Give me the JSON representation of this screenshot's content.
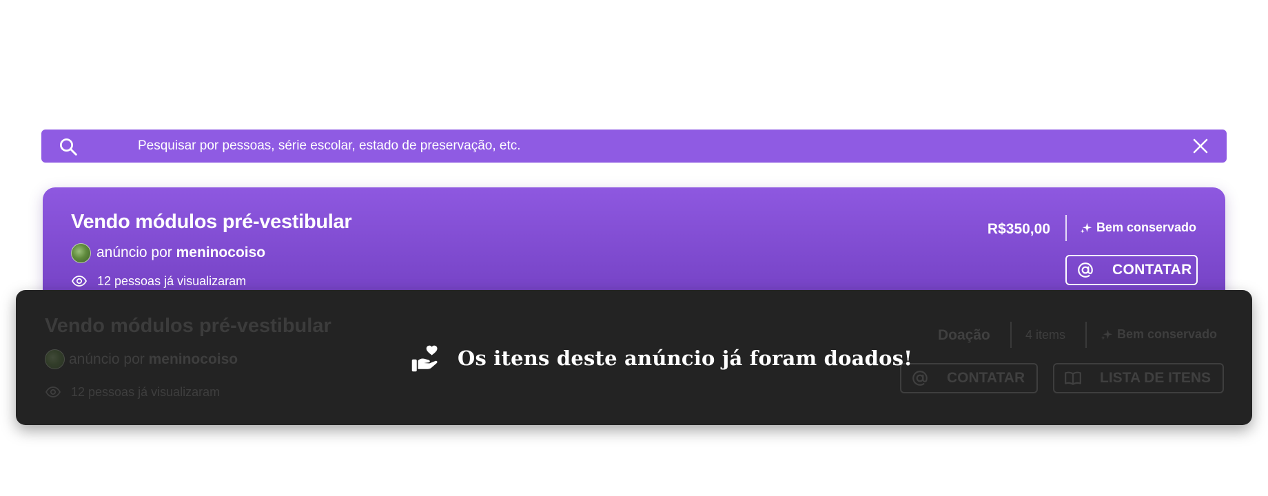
{
  "search": {
    "placeholder": "Pesquisar por pessoas, série escolar, estado de preservação, etc.",
    "icon": "search-icon",
    "clear_icon": "close-icon"
  },
  "listing": {
    "title": "Vendo módulos pré-vestibular",
    "author_prefix": "anúncio por",
    "author": "meninocoiso",
    "views": "12 pessoas já visualizaram",
    "price": "R$350,00",
    "condition": "Bem conservado",
    "contact_label": "CONTATAR"
  },
  "donated_listing": {
    "title": "Vendo módulos pré-vestibular",
    "author_prefix": "anúncio por",
    "author": "meninocoiso",
    "views": "12 pessoas já visualizaram",
    "type": "Doação",
    "items": "4 items",
    "condition": "Bem conservado",
    "contact_label": "CONTATAR",
    "items_list_label": "LISTA DE ITENS",
    "donated_message": "Os itens deste anúncio já foram doados!"
  },
  "colors": {
    "accent": "#8f5be3",
    "card_gradient_end": "#6f3dbe",
    "overlay": "#232323"
  }
}
